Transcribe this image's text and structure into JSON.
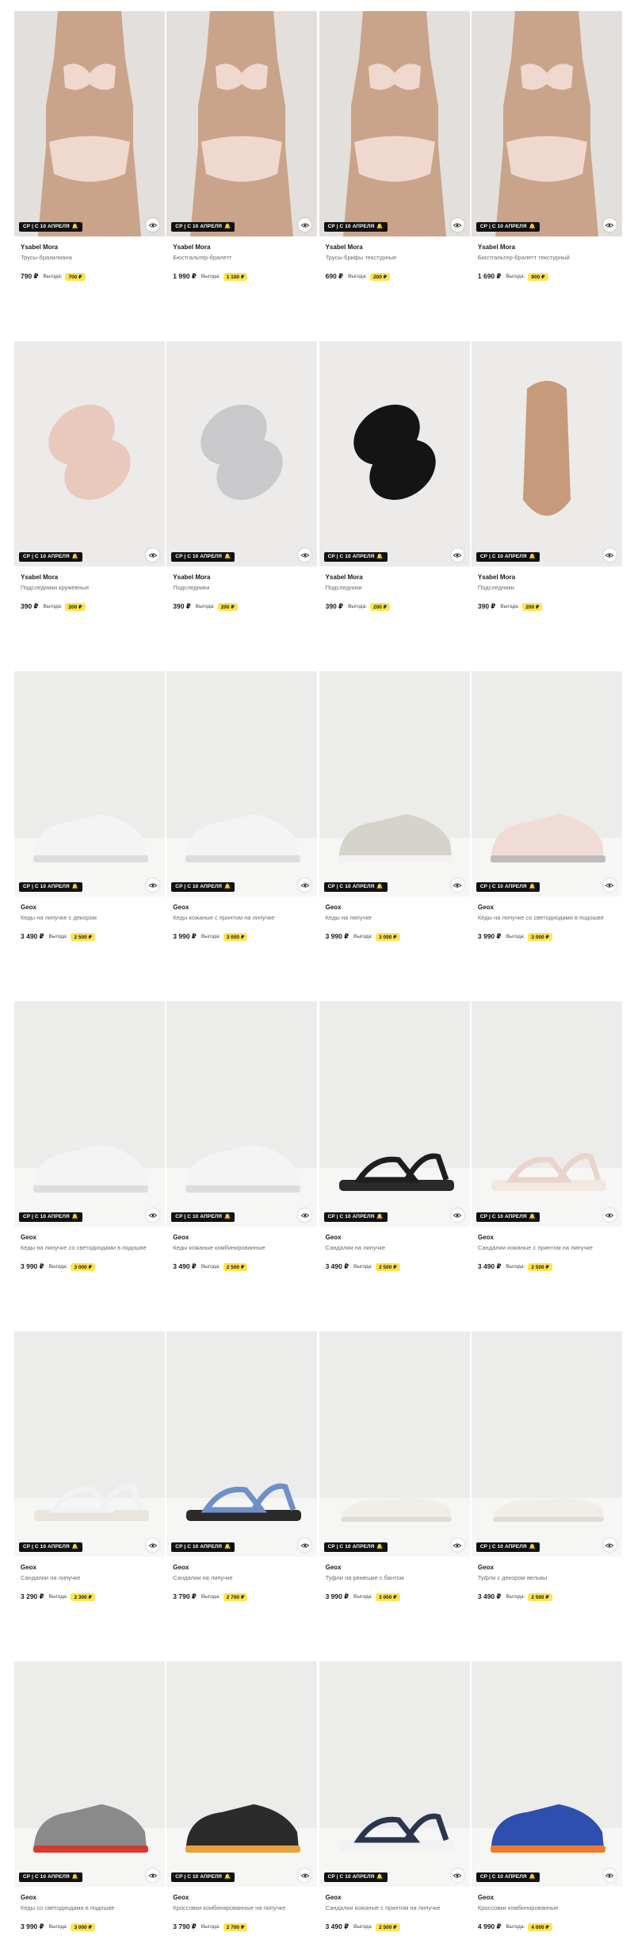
{
  "badge_text": "СР | С 10 АПРЕЛЯ",
  "save_label": "Выгода:",
  "colors": {
    "badge_bg": "#111111",
    "save_bg": "#ffe44d",
    "photo_bg": "#ececea"
  },
  "rows": [
    {
      "products": [
        {
          "brand": "Ysabel Mora",
          "title": "Трусы-бразилиана",
          "price": "790 ₽",
          "save": "700 ₽",
          "image": "lingerie-model"
        },
        {
          "brand": "Ysabel Mora",
          "title": "Бюстгальтер-бралетт",
          "price": "1 990 ₽",
          "save": "1 100 ₽",
          "image": "lingerie-model"
        },
        {
          "brand": "Ysabel Mora",
          "title": "Трусы-брифы текстурные",
          "price": "690 ₽",
          "save": "200 ₽",
          "image": "lingerie-model"
        },
        {
          "brand": "Ysabel Mora",
          "title": "Бюстгальтер-бралетт текстурный",
          "price": "1 690 ₽",
          "save": "900 ₽",
          "image": "lingerie-model"
        }
      ]
    },
    {
      "products": [
        {
          "brand": "Ysabel Mora",
          "title": "Подследники кружевные",
          "price": "390 ₽",
          "save": "200 ₽",
          "image": "socks-pink"
        },
        {
          "brand": "Ysabel Mora",
          "title": "Подследники",
          "price": "390 ₽",
          "save": "200 ₽",
          "image": "socks-grey"
        },
        {
          "brand": "Ysabel Mora",
          "title": "Подследники",
          "price": "390 ₽",
          "save": "200 ₽",
          "image": "socks-black"
        },
        {
          "brand": "Ysabel Mora",
          "title": "Подследники",
          "price": "390 ₽",
          "save": "200 ₽",
          "image": "sock-beige"
        }
      ]
    },
    {
      "products": [
        {
          "brand": "Geox",
          "title": "Кеды на липучке с декором",
          "price": "3 490 ₽",
          "save": "2 500 ₽",
          "image": "sneaker-white"
        },
        {
          "brand": "Geox",
          "title": "Кеды кожаные с принтом на липучке",
          "price": "3 990 ₽",
          "save": "3 000 ₽",
          "image": "sneaker-white"
        },
        {
          "brand": "Geox",
          "title": "Кеды на липучке",
          "price": "3 990 ₽",
          "save": "3 000 ₽",
          "image": "sneaker-grey"
        },
        {
          "brand": "Geox",
          "title": "Кеды на липучке со светодиодами в подошве",
          "price": "3 990 ₽",
          "save": "3 000 ₽",
          "image": "sneaker-pink"
        }
      ]
    },
    {
      "products": [
        {
          "brand": "Geox",
          "title": "Кеды на липучке со светодиодами в подошве",
          "price": "3 990 ₽",
          "save": "3 000 ₽",
          "image": "sneaker-white"
        },
        {
          "brand": "Geox",
          "title": "Кеды кожаные комбинированные",
          "price": "3 490 ₽",
          "save": "2 500 ₽",
          "image": "sneaker-white"
        },
        {
          "brand": "Geox",
          "title": "Сандалии на липучке",
          "price": "3 490 ₽",
          "save": "2 500 ₽",
          "image": "sandal-black"
        },
        {
          "brand": "Geox",
          "title": "Сандалии кожаные с принтом на липучке",
          "price": "3 490 ₽",
          "save": "2 500 ₽",
          "image": "sandal-pink"
        }
      ]
    },
    {
      "products": [
        {
          "brand": "Geox",
          "title": "Сандалии на липучке",
          "price": "3 290 ₽",
          "save": "2 300 ₽",
          "image": "sandal-white"
        },
        {
          "brand": "Geox",
          "title": "Сандалии на липучке",
          "price": "3 790 ₽",
          "save": "2 700 ₽",
          "image": "sandal-blue"
        },
        {
          "brand": "Geox",
          "title": "Туфли на ремешке с бантом",
          "price": "3 990 ₽",
          "save": "3 000 ₽",
          "image": "flat-white"
        },
        {
          "brand": "Geox",
          "title": "Туфли с декором вельвы",
          "price": "3 490 ₽",
          "save": "2 500 ₽",
          "image": "flat-white"
        }
      ]
    },
    {
      "products": [
        {
          "brand": "Geox",
          "title": "Кеды со светодиодами в подошве",
          "price": "3 990 ₽",
          "save": "3 000 ₽",
          "image": "sneaker-red"
        },
        {
          "brand": "Geox",
          "title": "Кроссовки комбинированные на липучке",
          "price": "3 790 ₽",
          "save": "2 700 ₽",
          "image": "sneaker-black"
        },
        {
          "brand": "Geox",
          "title": "Сандалии кожаные с принтом на липучке",
          "price": "3 490 ₽",
          "save": "2 500 ₽",
          "image": "sandal-navy"
        },
        {
          "brand": "Geox",
          "title": "Кроссовки комбинированные",
          "price": "4 990 ₽",
          "save": "4 000 ₽",
          "image": "sneaker-blue"
        }
      ]
    }
  ]
}
